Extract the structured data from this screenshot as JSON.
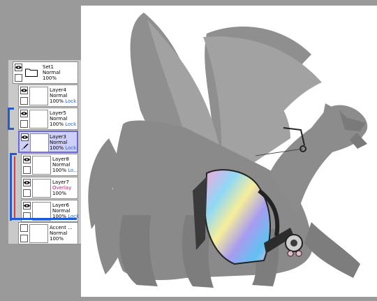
{
  "layers_panel": {
    "set": {
      "name": "Set1",
      "mode": "Normal",
      "opacity": "100%"
    },
    "layers": [
      {
        "name": "Layer4",
        "mode": "Normal",
        "opacity": "100%",
        "lock": "Lock"
      },
      {
        "name": "Layer5",
        "mode": "Normal",
        "opacity": "100%",
        "lock": "Lock"
      },
      {
        "name": "Layer3",
        "mode": "Normal",
        "opacity": "100%",
        "lock": "Lock",
        "selected": true
      },
      {
        "name": "Layer8",
        "mode": "Normal",
        "opacity": "100%",
        "lock": "Lo..."
      },
      {
        "name": "Layer7",
        "mode": "Overlay",
        "opacity": "100%",
        "lock": ""
      },
      {
        "name": "Layer6",
        "mode": "Normal",
        "opacity": "100%",
        "lock": "Lock"
      },
      {
        "name": "Accent ...",
        "mode": "Normal",
        "opacity": "100%",
        "lock": ""
      }
    ],
    "icons": {
      "visibility": "eye-icon",
      "folder": "folder-icon",
      "paint": "brush-icon"
    },
    "colors": {
      "selected_bg": "#cfd0f7",
      "selected_border": "#6a68d8",
      "lock_text": "#2a60c8",
      "overlay_text": "#c2186b",
      "clip_bracket_blue": "#1f5bd6",
      "clip_bracket_red": "#d93a3a"
    }
  },
  "canvas": {
    "background": "#ffffff",
    "subject": "grey dragon base with holographic saddle accent"
  }
}
